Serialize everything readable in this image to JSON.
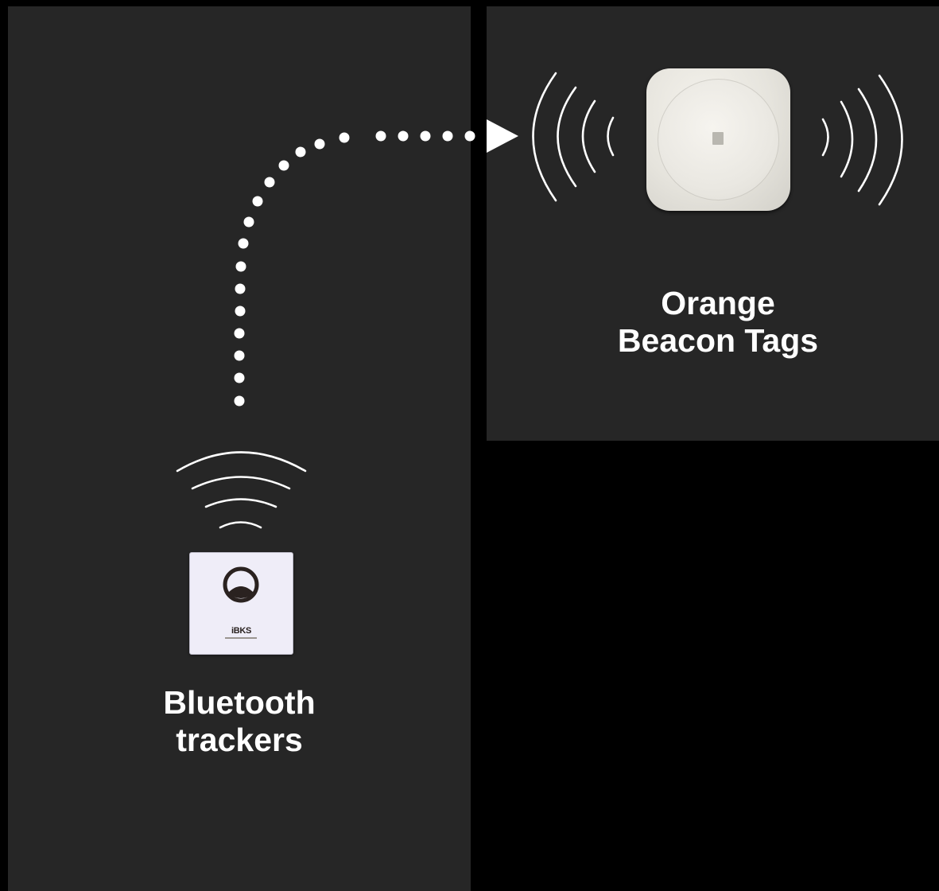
{
  "labels": {
    "trackers": "Bluetooth\ntrackers",
    "beacon": "Orange\nBeacon Tags"
  },
  "devices": {
    "tracker": {
      "brand": "iBKS",
      "icon": "ibks-tracker-device"
    },
    "beacon": {
      "icon": "orange-beacon-tag-device"
    }
  },
  "icons": {
    "signal_tracker": "wifi-waves-icon",
    "signal_beacon": "broadcast-waves-icon",
    "connector": "dotted-arrow-connector"
  },
  "colors": {
    "background": "#000000",
    "panel": "#262626",
    "text": "#ffffff"
  }
}
